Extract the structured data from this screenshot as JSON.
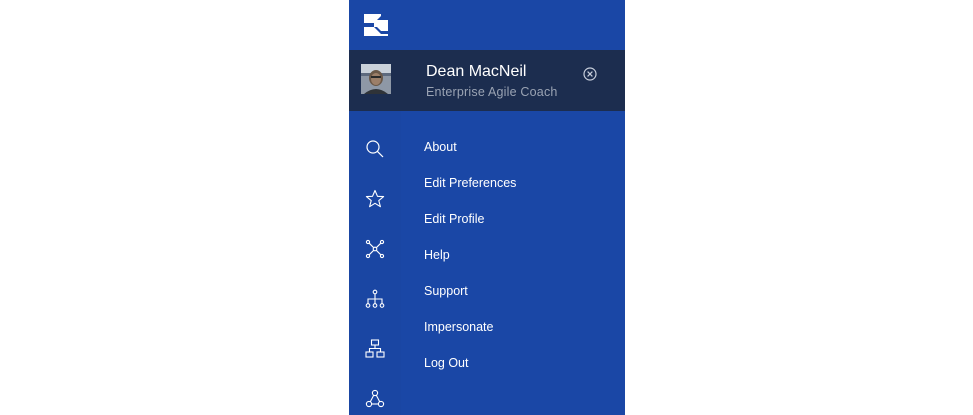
{
  "user": {
    "name": "Dean MacNeil",
    "title": "Enterprise Agile Coach"
  },
  "colors": {
    "panel": "#1a47a6",
    "user_card": "#1c2d4f",
    "text_primary": "#ffffff",
    "text_secondary": "#9aa3b3"
  },
  "icons": {
    "logo": "brand-logo-icon",
    "close": "close-circle-icon",
    "rail": [
      "search-icon",
      "star-icon",
      "network-icon",
      "hierarchy-icon",
      "org-chart-icon",
      "team-nodes-icon"
    ]
  },
  "menu": {
    "items": [
      {
        "label": "About"
      },
      {
        "label": "Edit Preferences"
      },
      {
        "label": "Edit Profile"
      },
      {
        "label": "Help"
      },
      {
        "label": "Support"
      },
      {
        "label": "Impersonate"
      },
      {
        "label": "Log Out"
      }
    ]
  }
}
